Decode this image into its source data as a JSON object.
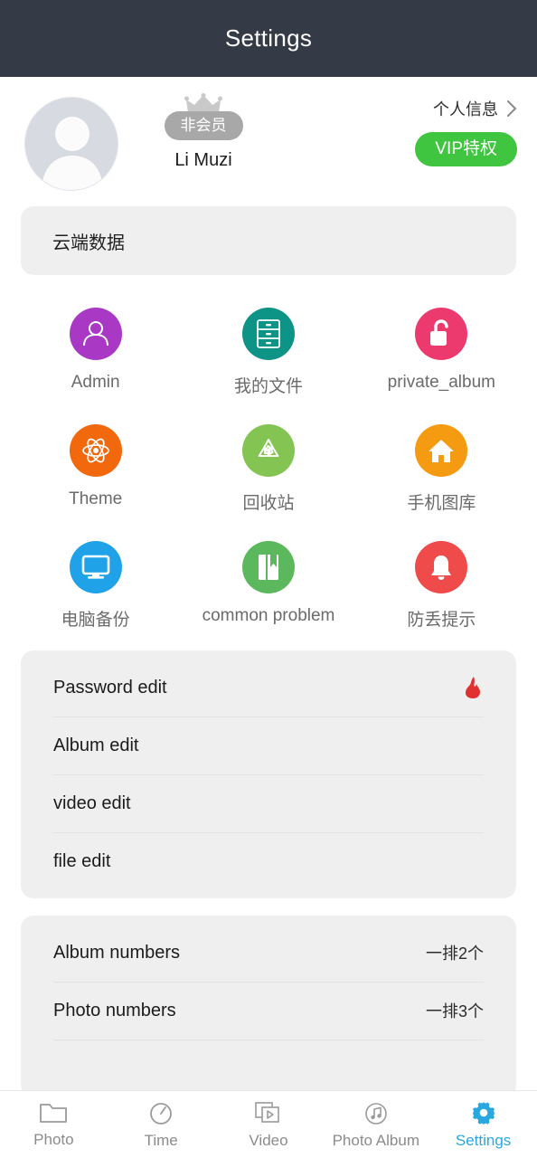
{
  "header": {
    "title": "Settings"
  },
  "profile": {
    "avatar_icon": "user-avatar-placeholder",
    "crown_icon": "crown-icon",
    "membership_badge": "非会员",
    "username": "Li Muzi",
    "info_link": "个人信息",
    "chevron_icon": "chevron-right-icon",
    "vip_button": "VIP特权"
  },
  "cloud": {
    "label": "云端数据"
  },
  "grid": {
    "items": [
      {
        "label": "Admin",
        "icon": "person-icon",
        "color": "#a939c4"
      },
      {
        "label": "我的文件",
        "icon": "file-cabinet-icon",
        "color": "#0e9387"
      },
      {
        "label": "private_album",
        "icon": "open-lock-icon",
        "color": "#ed3a6e"
      },
      {
        "label": "Theme",
        "icon": "atom-icon",
        "color": "#f2690d"
      },
      {
        "label": "回收站",
        "icon": "recycle-icon",
        "color": "#84c452"
      },
      {
        "label": "手机图库",
        "icon": "home-icon",
        "color": "#f59b11"
      },
      {
        "label": "电脑备份",
        "icon": "monitor-icon",
        "color": "#1fa2e8"
      },
      {
        "label": "common problem",
        "icon": "book-icon",
        "color": "#5cb85c"
      },
      {
        "label": "防丢提示",
        "icon": "bell-icon",
        "color": "#f04b4b"
      }
    ]
  },
  "edit_section": {
    "rows": [
      {
        "label": "Password edit",
        "badge_icon": "flame-icon"
      },
      {
        "label": "Album edit",
        "badge_icon": ""
      },
      {
        "label": "video edit",
        "badge_icon": ""
      },
      {
        "label": "file edit",
        "badge_icon": ""
      }
    ]
  },
  "numbers_section": {
    "rows": [
      {
        "label": "Album numbers",
        "value": "一排2个"
      },
      {
        "label": "Photo numbers",
        "value": "一排3个"
      }
    ]
  },
  "tabbar": {
    "items": [
      {
        "label": "Photo",
        "icon": "folder-icon",
        "active": false
      },
      {
        "label": "Time",
        "icon": "clock-icon",
        "active": false
      },
      {
        "label": "Video",
        "icon": "video-stack-icon",
        "active": false
      },
      {
        "label": "Photo Album",
        "icon": "music-note-icon",
        "active": false
      },
      {
        "label": "Settings",
        "icon": "gear-icon",
        "active": true
      }
    ]
  },
  "colors": {
    "header_bg": "#343a46",
    "card_bg": "#efeff0",
    "accent_green": "#3fc53f",
    "accent_blue": "#29a8e0",
    "badge_gray": "#a8a8a8",
    "flame_red": "#e03030"
  }
}
